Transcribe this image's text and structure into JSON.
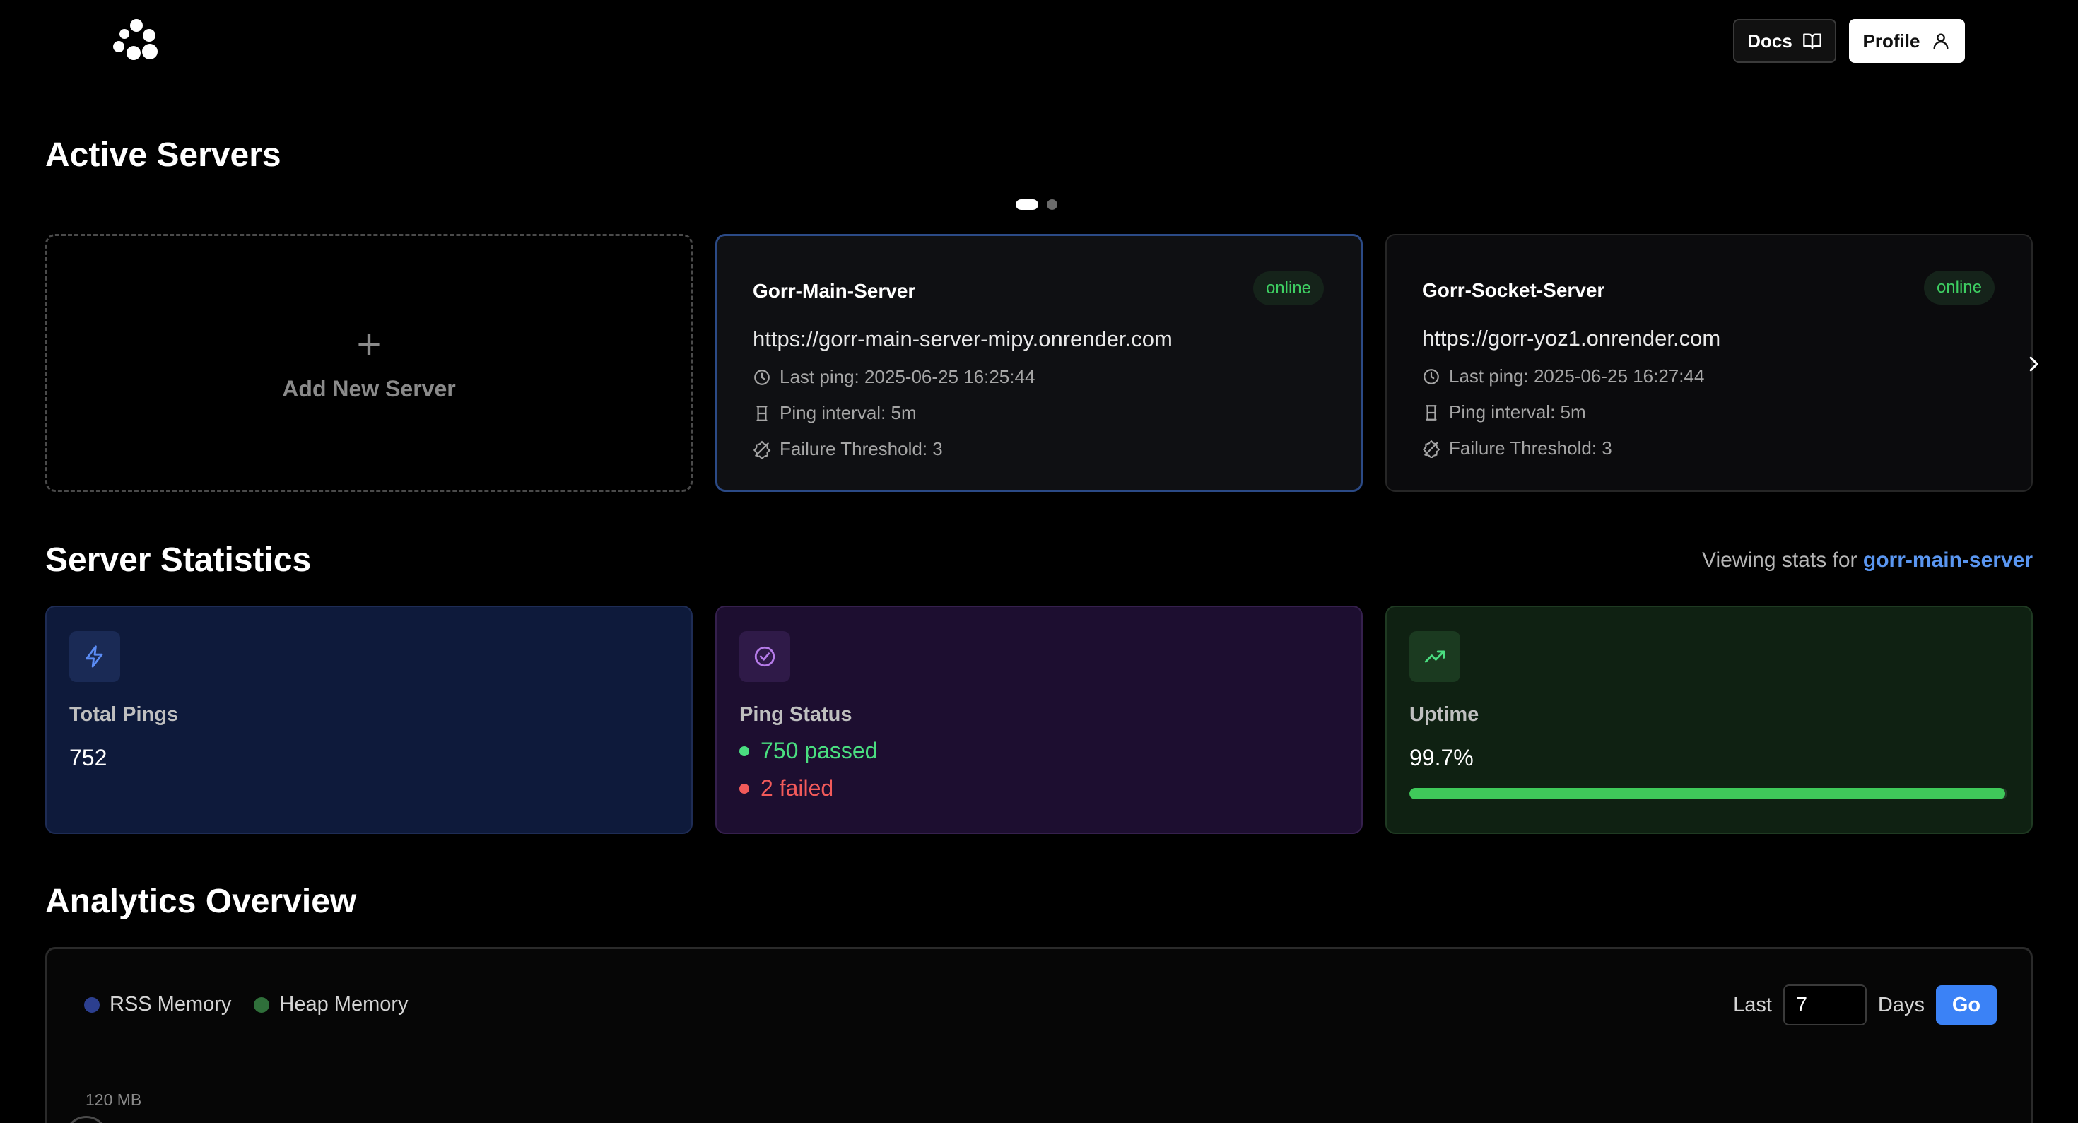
{
  "header": {
    "docs_label": "Docs",
    "profile_label": "Profile"
  },
  "active_servers": {
    "title": "Active Servers",
    "pager": {
      "current_page": 1,
      "total_pages": 2
    },
    "add_label": "Add New Server",
    "servers": [
      {
        "name": "Gorr-Main-Server",
        "status": "online",
        "url": "https://gorr-main-server-mipy.onrender.com",
        "last_ping": "Last ping: 2025-06-25 16:25:44",
        "ping_interval": "Ping interval: 5m",
        "failure_threshold": "Failure Threshold: 3",
        "selected": true
      },
      {
        "name": "Gorr-Socket-Server",
        "status": "online",
        "url": "https://gorr-yoz1.onrender.com",
        "last_ping": "Last ping: 2025-06-25 16:27:44",
        "ping_interval": "Ping interval: 5m",
        "failure_threshold": "Failure Threshold: 3",
        "selected": false
      }
    ]
  },
  "statistics": {
    "title": "Server Statistics",
    "viewing_prefix": "Viewing stats for",
    "viewing_server": "gorr-main-server",
    "total_pings": {
      "label": "Total Pings",
      "value": "752"
    },
    "ping_status": {
      "label": "Ping Status",
      "passed": "750 passed",
      "failed": "2 failed"
    },
    "uptime": {
      "label": "Uptime",
      "value": "99.7%",
      "fraction": 0.997
    }
  },
  "analytics": {
    "title": "Analytics Overview",
    "legend": [
      {
        "label": "RSS Memory",
        "color": "#2c3f8f"
      },
      {
        "label": "Heap Memory",
        "color": "#2f6f3a"
      }
    ],
    "range_prefix": "Last",
    "range_value": "7",
    "range_suffix": "Days",
    "go_label": "Go",
    "y_tick_top": "120 MB"
  },
  "colors": {
    "online": "#3ecf62",
    "accent_blue": "#3b82f6",
    "passed": "#4ade80",
    "failed": "#f25a5a"
  }
}
